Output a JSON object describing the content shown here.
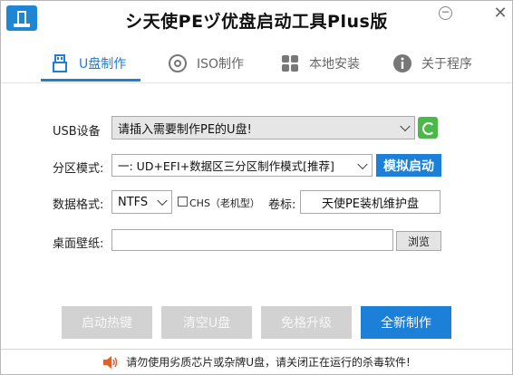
{
  "window": {
    "title": "シ天使PEヅ优盘启动工具Plus版",
    "minimize_glyph": "−",
    "close_glyph": "✕"
  },
  "tabs": [
    {
      "label": "U盘制作",
      "icon": "usb-icon",
      "active": true
    },
    {
      "label": "ISO制作",
      "icon": "disc-icon",
      "active": false
    },
    {
      "label": "本地安装",
      "icon": "grid-icon",
      "active": false
    },
    {
      "label": "关于程序",
      "icon": "info-icon",
      "active": false
    }
  ],
  "form": {
    "usb_device": {
      "label": "USB设备",
      "value": "请插入需要制作PE的U盘!"
    },
    "partition_mode": {
      "label": "分区模式:",
      "value": "一: UD+EFI+数据区三分区制作模式[推荐]"
    },
    "simulate_button": "模拟启动",
    "data_format": {
      "label": "数据格式:",
      "value": "NTFS"
    },
    "chs": {
      "label": "CHS（老机型）",
      "checked": false
    },
    "volume_label": {
      "label": "卷标:",
      "value": "天使PE装机维护盘"
    },
    "wallpaper": {
      "label": "桌面壁纸:",
      "value": "",
      "browse_label": "浏览"
    }
  },
  "actions": [
    {
      "label": "启动热键",
      "enabled": false
    },
    {
      "label": "清空U盘",
      "enabled": false
    },
    {
      "label": "免格升级",
      "enabled": false
    },
    {
      "label": "全新制作",
      "enabled": true
    }
  ],
  "footer": {
    "warning": "请勿使用劣质芯片或杂牌U盘，请关闭正在运行的杀毒软件!"
  },
  "colors": {
    "accent": "#1c7fd8",
    "refresh": "#4bb84a",
    "disabled": "#d2d2d2"
  }
}
